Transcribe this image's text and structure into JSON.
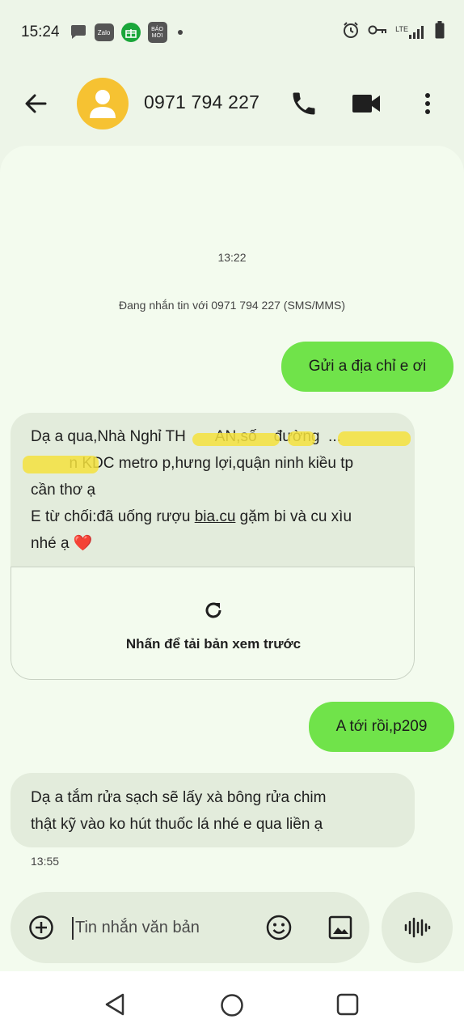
{
  "status_bar": {
    "time": "15:24",
    "icons": [
      "chat-bubble-icon",
      "zalo-icon",
      "gift-icon",
      "baomoi-icon",
      "notification-dot",
      "alarm-icon",
      "vpn-key-icon",
      "lte-signal-icon",
      "signal-icon",
      "battery-icon"
    ],
    "zalo_label": "Zalo",
    "baomoi_label": "BÁO MỚI",
    "network": "LTE"
  },
  "header": {
    "contact": "0971 794 227",
    "avatar_color": "#f6c232",
    "icons": [
      "back-arrow-icon",
      "person-icon",
      "phone-icon",
      "video-camera-icon",
      "more-vert-icon"
    ]
  },
  "conversation": {
    "timestamp_top": "13:22",
    "info": "Đang nhắn tin với 0971 794 227 (SMS/MMS)",
    "messages": [
      {
        "direction": "outgoing",
        "text": "Gửi a địa chỉ e ơi"
      },
      {
        "direction": "incoming",
        "lines": [
          "Dạ a qua,Nhà Nghỉ TH       AN,số    đường  ...",
          "         n KDC metro p,hưng lợi,quận ninh kiều tp",
          "cần thơ ạ",
          "E từ chối:đã uống rượu bia.cu gặm bi và cu xìu",
          "nhé ạ ❤️"
        ],
        "link_text": "bia.cu",
        "link_preview_label": "Nhấn để tải bản xem trước"
      },
      {
        "direction": "outgoing",
        "text": "A tới rồi,p209"
      },
      {
        "direction": "incoming",
        "lines": [
          "Dạ a tắm rửa sạch sẽ lấy xà bông rửa chim",
          "thật kỹ vào ko hút thuốc lá nhé e qua liền ạ"
        ]
      }
    ],
    "timestamp_bottom": "13:55"
  },
  "composer": {
    "placeholder": "Tin nhắn văn bản",
    "icons": [
      "add-circle-icon",
      "emoji-icon",
      "image-icon",
      "voice-waveform-icon"
    ]
  },
  "nav": {
    "icons": [
      "nav-back-icon",
      "nav-home-icon",
      "nav-recents-icon"
    ]
  },
  "colors": {
    "outgoing_bubble": "#70e34a",
    "incoming_bubble": "#e3ecdc",
    "background": "#f3fbee",
    "redaction": "#f4e23d"
  }
}
